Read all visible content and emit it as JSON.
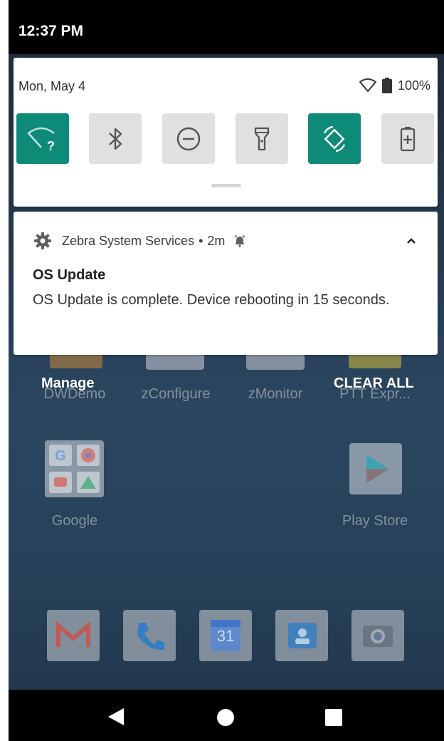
{
  "status_bar": {
    "time": "12:37 PM"
  },
  "quick_settings": {
    "date": "Mon, May 4",
    "battery_percent": "100%",
    "tiles": [
      {
        "name": "wifi",
        "on": true,
        "icon": "wifi-question-icon"
      },
      {
        "name": "bluetooth",
        "on": false,
        "icon": "bluetooth-icon"
      },
      {
        "name": "do-not-disturb",
        "on": false,
        "icon": "dnd-icon"
      },
      {
        "name": "flashlight",
        "on": false,
        "icon": "flashlight-icon"
      },
      {
        "name": "auto-rotate",
        "on": true,
        "icon": "rotate-icon"
      },
      {
        "name": "battery-saver",
        "on": false,
        "icon": "battery-saver-icon"
      }
    ]
  },
  "notification": {
    "app_name": "Zebra System Services",
    "separator": "•",
    "time": "2m",
    "title": "OS Update",
    "body": "OS Update is complete. Device rebooting in 15 seconds."
  },
  "shade_actions": {
    "manage_label": "Manage",
    "clear_all_label": "CLEAR ALL"
  },
  "home": {
    "apps_row1": [
      "DWDemo",
      "zConfigure",
      "zMonitor",
      "PTT Expr..."
    ],
    "apps_row2": [
      "Google",
      "Play Store"
    ],
    "dock_icons": [
      "gmail-icon",
      "phone-icon",
      "calendar-icon",
      "contacts-icon",
      "camera-icon"
    ],
    "calendar_day": "31"
  },
  "colors": {
    "accent_teal": "#0e8a78",
    "tile_off": "#e0e0e0"
  }
}
